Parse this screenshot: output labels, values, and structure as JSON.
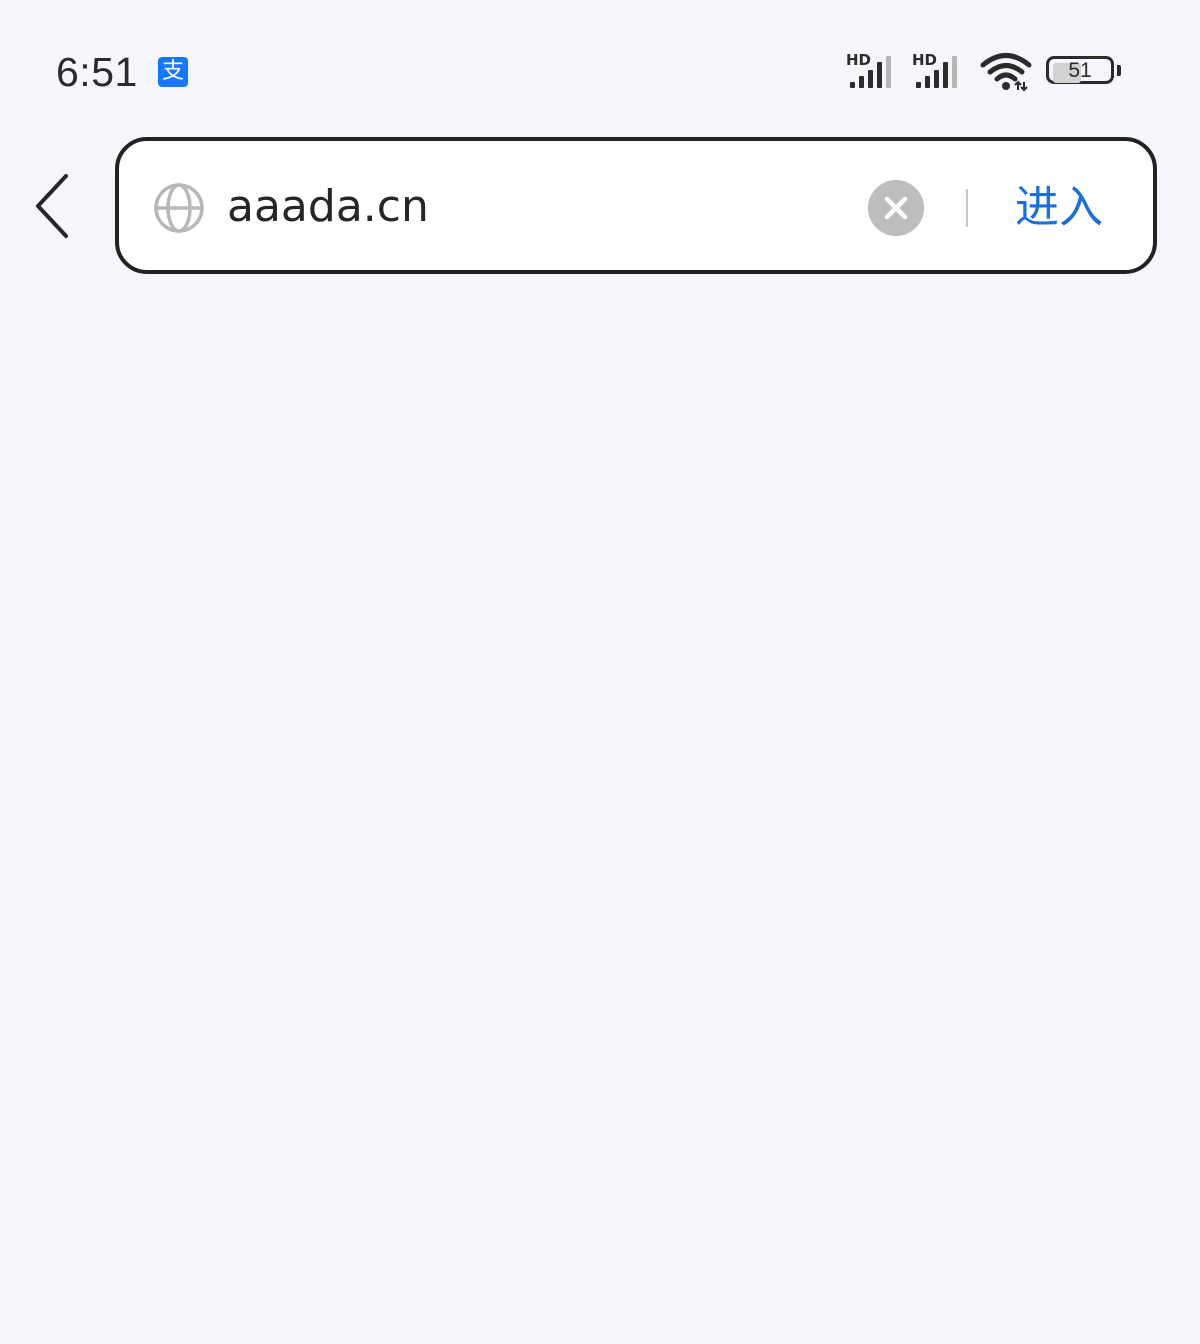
{
  "status_bar": {
    "time": "6:51",
    "notification_icon": "alipay-icon",
    "notification_glyph": "支",
    "signal_1_label": "HD",
    "signal_2_label": "HD",
    "battery_level": "51",
    "battery_fraction": 0.51
  },
  "address_bar": {
    "back_icon": "chevron-left-icon",
    "site_icon": "globe-icon",
    "url_value": "aaada.cn",
    "clear_icon": "clear-icon",
    "enter_label": "进入"
  },
  "colors": {
    "background": "#f4f6fb",
    "accent": "#1a6fd9",
    "alipay_blue": "#1677ff"
  }
}
